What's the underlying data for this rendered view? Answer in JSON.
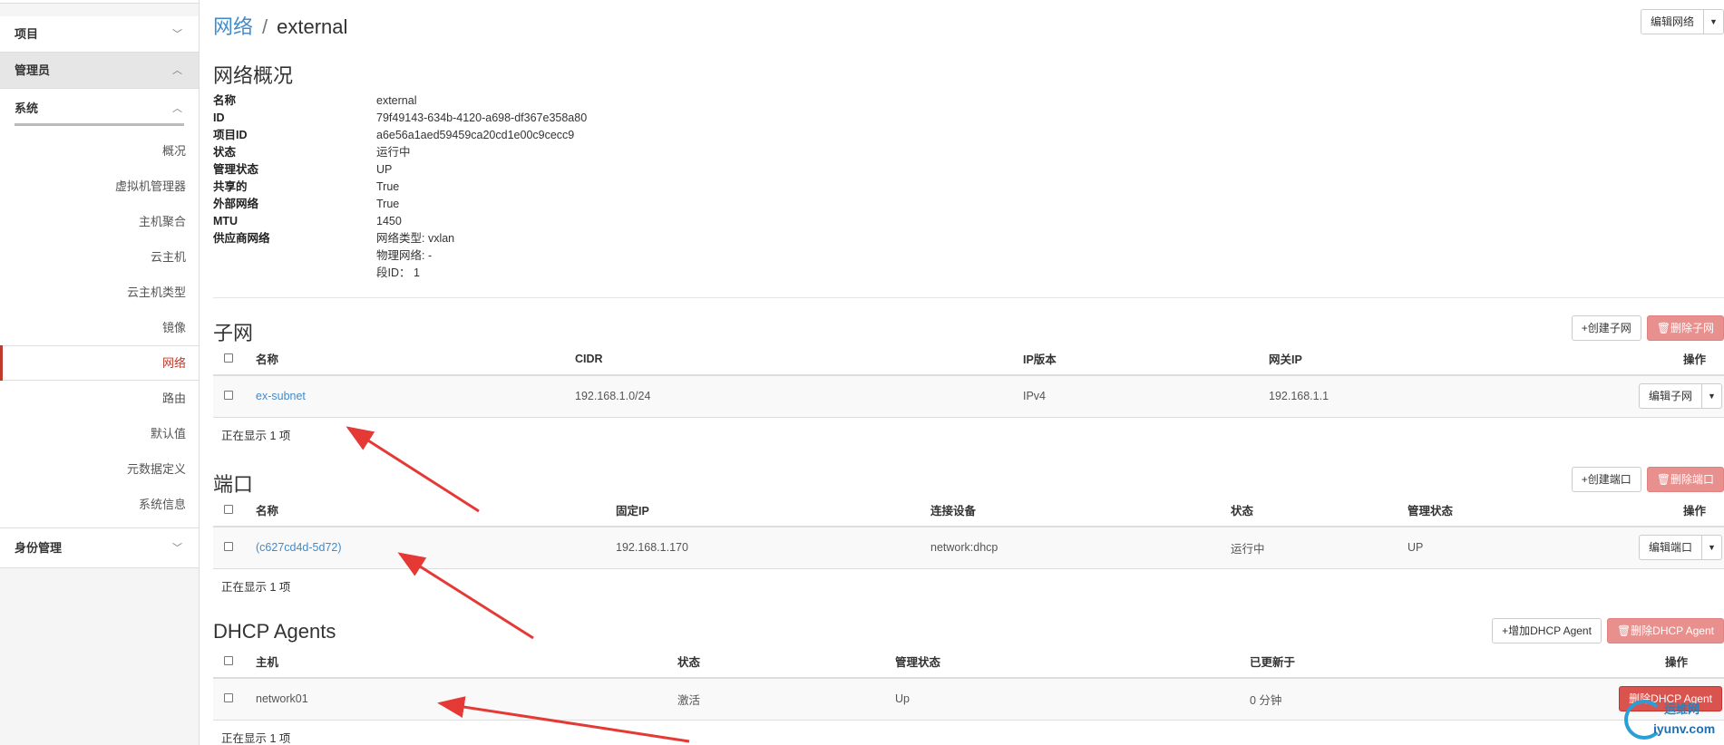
{
  "sidebar": {
    "project": "项目",
    "admin": "管理员",
    "system": "系统",
    "items": [
      "概况",
      "虚拟机管理器",
      "主机聚合",
      "云主机",
      "云主机类型",
      "镜像",
      "网络",
      "路由",
      "默认值",
      "元数据定义",
      "系统信息"
    ],
    "active_item": "网络",
    "identity": "身份管理"
  },
  "breadcrumb": {
    "parent": "网络",
    "sep": "/",
    "current": "external"
  },
  "header_actions": {
    "edit_network": "编辑网络"
  },
  "overview": {
    "title": "网络概况",
    "rows": [
      {
        "key": "名称",
        "value": "external"
      },
      {
        "key": "ID",
        "value": "79f49143-634b-4120-a698-df367e358a80"
      },
      {
        "key": "项目ID",
        "value": "a6e56a1aed59459ca20cd1e00c9cecc9"
      },
      {
        "key": "状态",
        "value": "运行中"
      },
      {
        "key": "管理状态",
        "value": "UP"
      },
      {
        "key": "共享的",
        "value": "True"
      },
      {
        "key": "外部网络",
        "value": "True"
      },
      {
        "key": "MTU",
        "value": "1450"
      },
      {
        "key": "供应商网络",
        "value": "网络类型: vxlan"
      },
      {
        "key": "",
        "value": "物理网络: -"
      },
      {
        "key": "",
        "value": "段ID： 1"
      }
    ]
  },
  "subnets": {
    "title": "子网",
    "create": "+创建子网",
    "delete": "删除子网",
    "headers": [
      "名称",
      "CIDR",
      "IP版本",
      "网关IP",
      "操作"
    ],
    "rows": [
      [
        "ex-subnet",
        "192.168.1.0/24",
        "IPv4",
        "192.168.1.1",
        "编辑子网"
      ]
    ],
    "count": "正在显示 1 项"
  },
  "ports": {
    "title": "端口",
    "create": "+创建端口",
    "delete": "删除端口",
    "headers": [
      "名称",
      "固定IP",
      "连接设备",
      "状态",
      "管理状态",
      "操作"
    ],
    "rows": [
      [
        "(c627cd4d-5d72)",
        "192.168.1.170",
        "network:dhcp",
        "运行中",
        "UP",
        "编辑端口"
      ]
    ],
    "count": "正在显示 1 项"
  },
  "agents": {
    "title": "DHCP Agents",
    "create": "+增加DHCP Agent",
    "delete": "删除DHCP Agent",
    "headers": [
      "主机",
      "状态",
      "管理状态",
      "已更新于",
      "操作"
    ],
    "rows": [
      [
        "network01",
        "激活",
        "Up",
        "0 分钟",
        "删除DHCP Agent"
      ]
    ],
    "count": "正在显示 1 项"
  },
  "watermark": {
    "top": "运维网",
    "bottom": "iyunv.com"
  },
  "colors": {
    "link": "#428bca",
    "danger": "#d9534f",
    "danger_dim": "#e8908e",
    "active": "#c0392b",
    "arrow": "#e53935"
  }
}
